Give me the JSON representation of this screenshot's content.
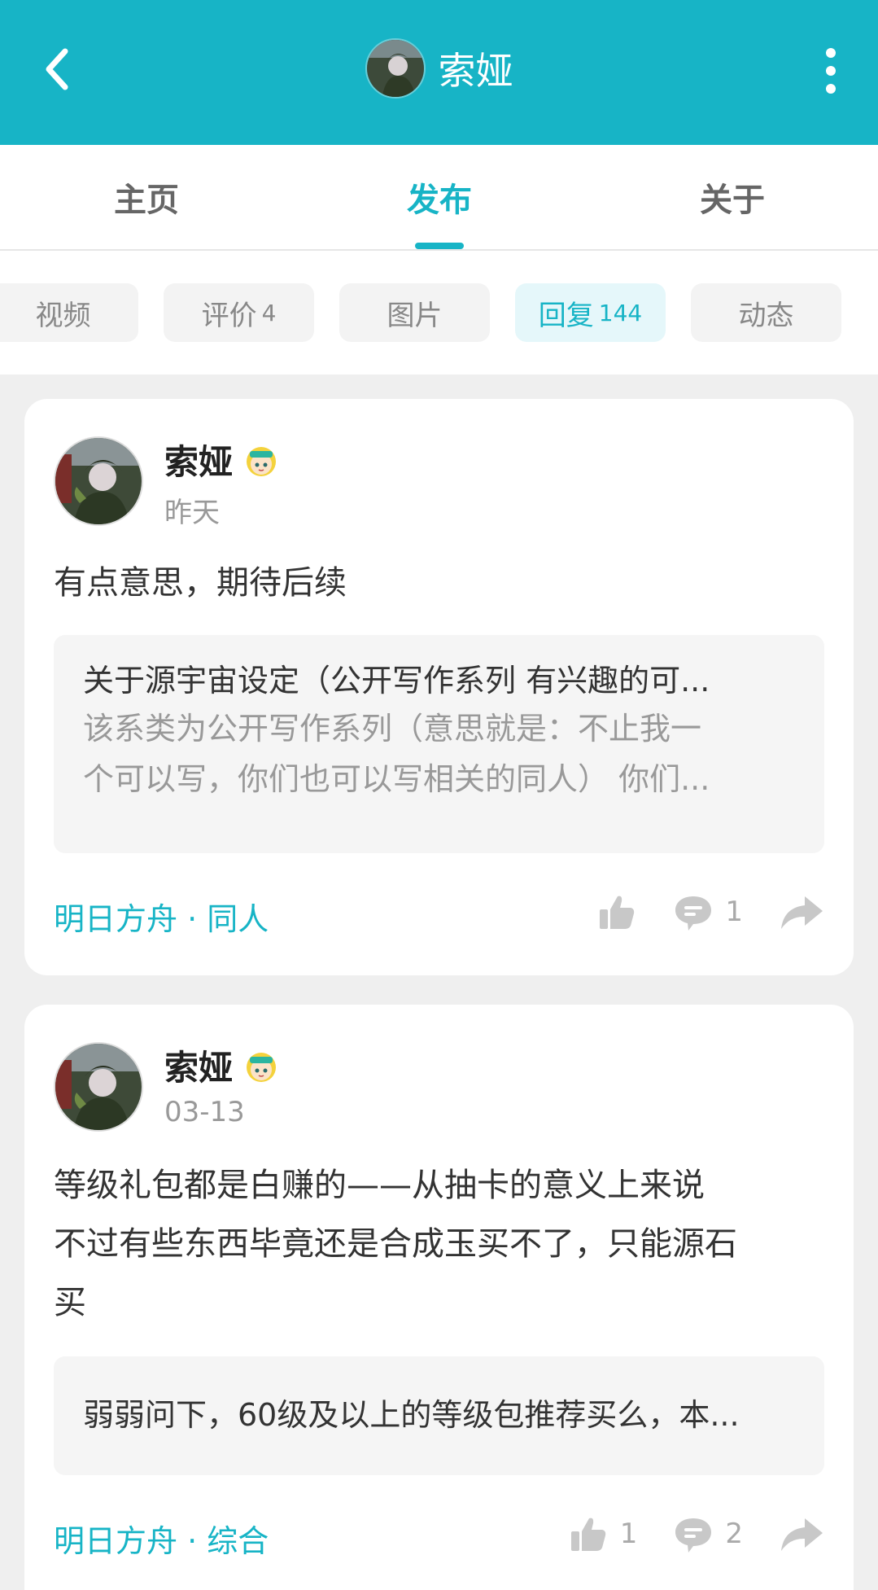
{
  "header": {
    "title": "索娅"
  },
  "tabs": [
    {
      "label": "主页"
    },
    {
      "label": "发布"
    },
    {
      "label": "关于"
    }
  ],
  "chips": [
    {
      "label": "视频",
      "count": ""
    },
    {
      "label": "评价",
      "count": "4"
    },
    {
      "label": "图片",
      "count": ""
    },
    {
      "label": "回复",
      "count": "144"
    },
    {
      "label": "动态",
      "count": ""
    }
  ],
  "posts": [
    {
      "author": "索娅",
      "time": "昨天",
      "content": "有点意思，期待后续",
      "quote_title": "关于源宇宙设定（公开写作系列 有兴趣的可...",
      "quote_body_1": "该系类为公开写作系列（意思就是：不止我一",
      "quote_body_2": "个可以写，你们也可以写相关的同人） 你们...",
      "tag": "明日方舟 · 同人",
      "likes": "",
      "comments": "1"
    },
    {
      "author": "索娅",
      "time": "03-13",
      "content_1": "等级礼包都是白赚的——从抽卡的意义上来说",
      "content_2": "不过有些东西毕竟还是合成玉买不了，只能源石",
      "content_3": "买",
      "quote_title": "弱弱问下，60级及以上的等级包推荐买么，本...",
      "tag": "明日方舟 · 综合",
      "likes": "1",
      "comments": "2"
    }
  ],
  "colors": {
    "accent": "#17b4c6",
    "background": "#efefef"
  }
}
